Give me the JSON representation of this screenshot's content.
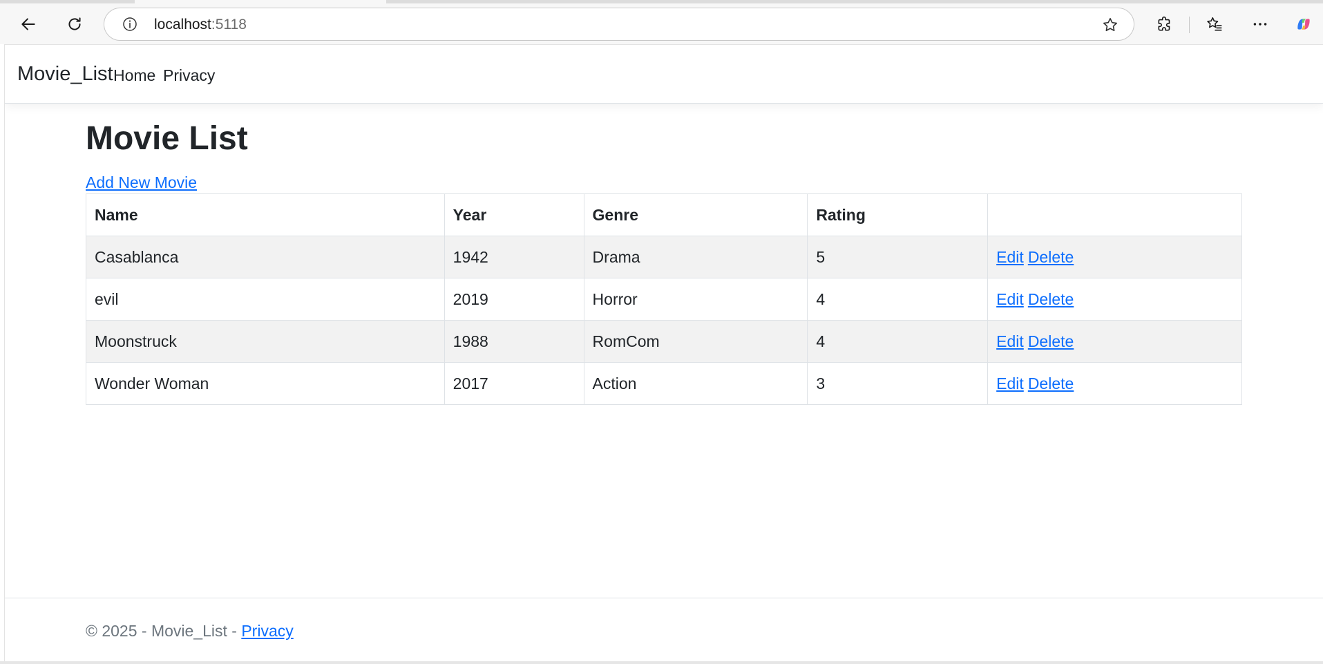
{
  "browser": {
    "address": {
      "host": "localhost",
      "port": ":5118"
    },
    "icons": {
      "back": "back-arrow-icon",
      "reload": "reload-icon",
      "site_info": "info-icon",
      "favorite": "star-icon",
      "extensions": "puzzle-icon",
      "favorites": "favorites-icon",
      "more": "more-icon",
      "copilot": "copilot-icon"
    }
  },
  "navbar": {
    "brand": "Movie_List",
    "links": [
      "Home",
      "Privacy"
    ]
  },
  "main": {
    "title": "Movie List",
    "add_link": "Add New Movie",
    "table": {
      "headers": [
        "Name",
        "Year",
        "Genre",
        "Rating",
        ""
      ],
      "rows": [
        {
          "name": "Casablanca",
          "year": "1942",
          "genre": "Drama",
          "rating": "5",
          "edit": "Edit",
          "delete": "Delete"
        },
        {
          "name": "evil",
          "year": "2019",
          "genre": "Horror",
          "rating": "4",
          "edit": "Edit",
          "delete": "Delete"
        },
        {
          "name": "Moonstruck",
          "year": "1988",
          "genre": "RomCom",
          "rating": "4",
          "edit": "Edit",
          "delete": "Delete"
        },
        {
          "name": "Wonder Woman",
          "year": "2017",
          "genre": "Action",
          "rating": "3",
          "edit": "Edit",
          "delete": "Delete"
        }
      ]
    }
  },
  "footer": {
    "text": "© 2025 - Movie_List - ",
    "privacy_link": "Privacy"
  },
  "colors": {
    "link": "#0d6efd",
    "text": "#212529",
    "muted": "#6c757d",
    "striped_row": "#f2f2f2"
  }
}
